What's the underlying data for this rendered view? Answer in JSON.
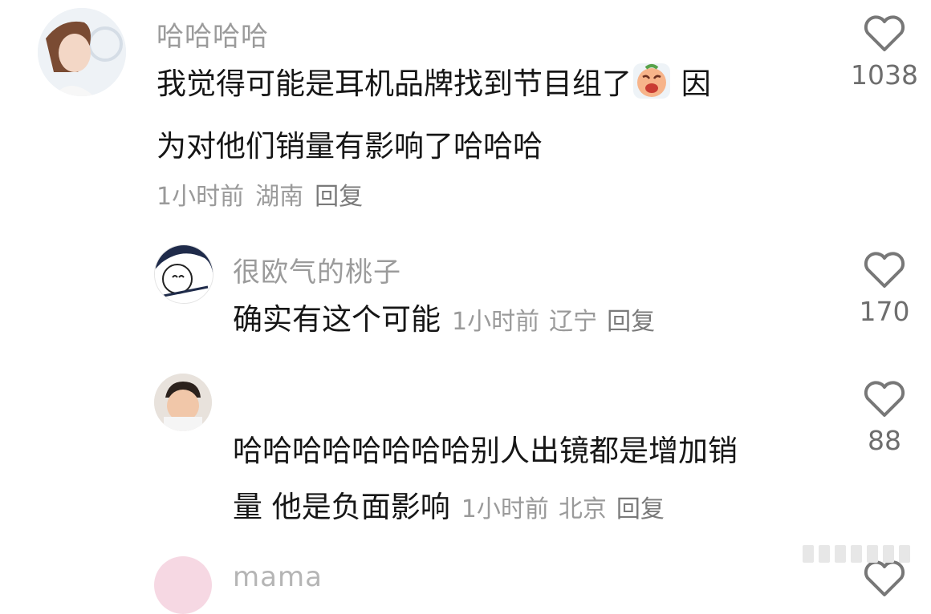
{
  "comments": [
    {
      "username": "哈哈哈哈",
      "text_line1": "我觉得可能是耳机品牌找到节目组了",
      "emoji": "crying-face-emoji",
      "text_line1_tail": "因",
      "text_line2": "为对他们销量有影响了哈哈哈",
      "time": "1小时前",
      "location": "湖南",
      "reply": "回复",
      "likes": "1038"
    },
    {
      "username": "很欧气的桃子",
      "text": "确实有这个可能",
      "time": "1小时前",
      "location": "辽宁",
      "reply": "回复",
      "likes": "170"
    },
    {
      "username": "",
      "text_line1": "哈哈哈哈哈哈哈哈别人出镜都是增加销",
      "text_line2": "量 他是负面影响",
      "time": "1小时前",
      "location": "北京",
      "reply": "回复",
      "likes": "88"
    },
    {
      "username": "mama"
    }
  ],
  "colors": {
    "username": "#9b9b9b",
    "text": "#161616",
    "meta": "#9a9a9a",
    "heart_stroke": "#777777"
  }
}
